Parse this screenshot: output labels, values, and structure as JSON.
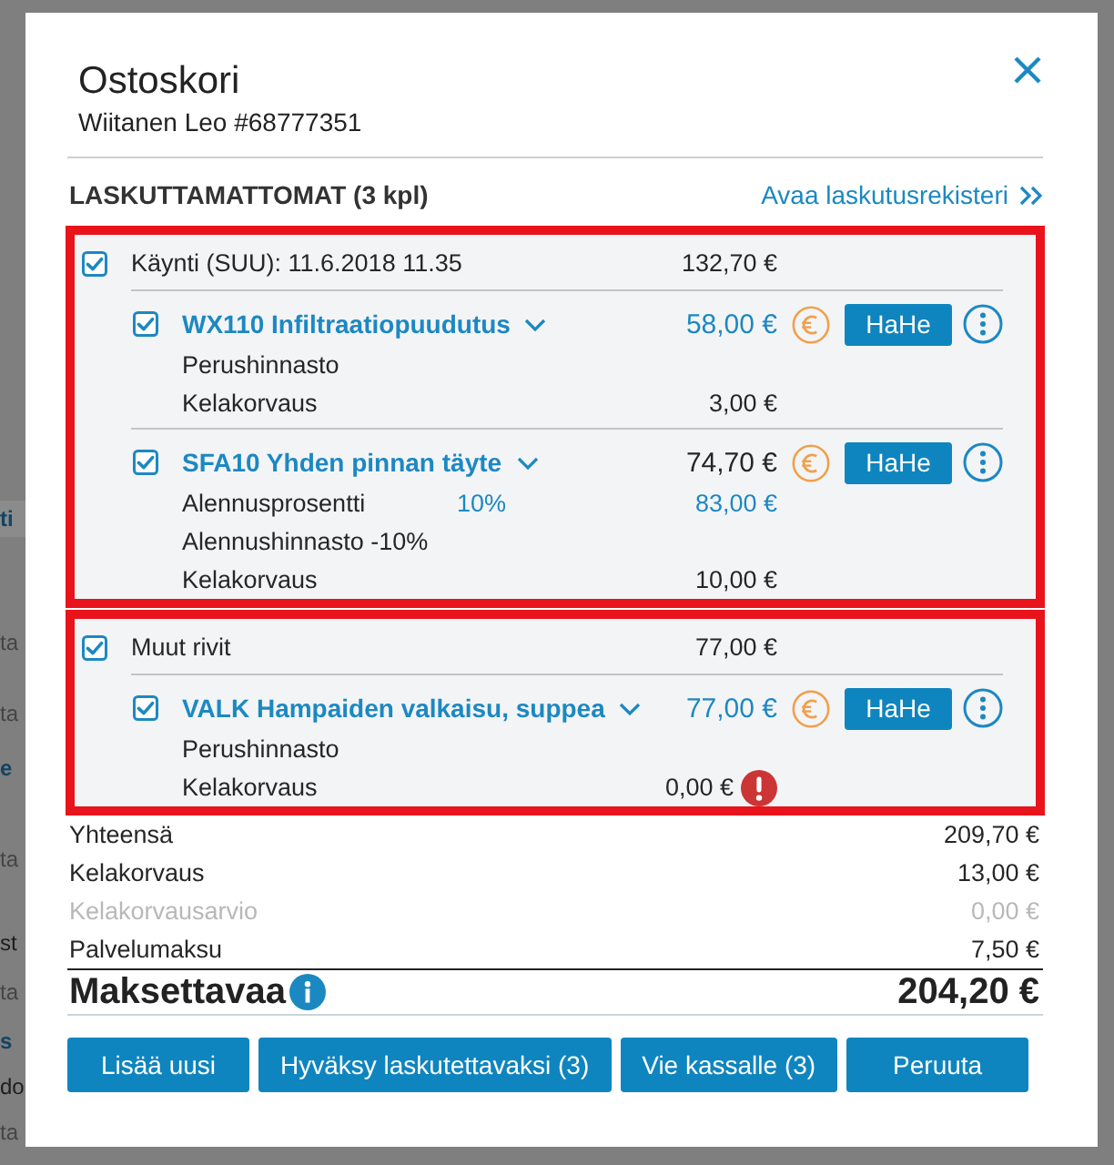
{
  "background_page": {
    "fragments": [
      {
        "text": "ti",
        "kind": "link",
        "selected": true
      },
      {
        "text": "ta",
        "kind": "meta",
        "selected": false
      },
      {
        "text": "ta",
        "kind": "meta",
        "selected": false
      },
      {
        "text": "e",
        "kind": "link",
        "selected": false
      },
      {
        "text": "ta",
        "kind": "meta",
        "selected": false
      },
      {
        "text": "st",
        "kind": "text",
        "selected": false
      },
      {
        "text": "ta",
        "kind": "meta",
        "selected": false
      },
      {
        "text": "s",
        "kind": "link",
        "selected": false
      },
      {
        "text": "do",
        "kind": "text",
        "selected": false
      },
      {
        "text": "ta",
        "kind": "meta",
        "selected": false
      }
    ]
  },
  "dialog": {
    "title": "Ostoskori",
    "subtitle": "Wiitanen Leo #68777351"
  },
  "section": {
    "title": "LASKUTTAMATTOMAT (3 kpl)",
    "link": "Avaa laskutusrekisteri"
  },
  "groups": [
    {
      "checked": true,
      "highlighted": true,
      "label": "Käynti (SUU): 11.6.2018 11.35",
      "amount": "132,70 €",
      "items": [
        {
          "checked": true,
          "name": "WX110 Infiltraatiopuudutus",
          "price": "58,00 €",
          "price_highlighted": true,
          "action": "HaHe",
          "lines": [
            {
              "kind": "price_list",
              "label": "Perushinnasto",
              "warning": false
            },
            {
              "kind": "reimbursement",
              "label": "Kelakorvaus",
              "value": "3,00 €",
              "warning": false
            }
          ]
        },
        {
          "checked": true,
          "name": "SFA10 Yhden pinnan täyte",
          "price": "74,70 €",
          "price_highlighted": false,
          "action": "HaHe",
          "lines": [
            {
              "kind": "discount",
              "label": "Alennusprosentti",
              "rate": "10%",
              "value": "83,00 €",
              "warning": false
            },
            {
              "kind": "price_list",
              "label": "Alennushinnasto -10%",
              "warning": false
            },
            {
              "kind": "reimbursement",
              "label": "Kelakorvaus",
              "value": "10,00 €",
              "warning": false
            }
          ]
        }
      ]
    },
    {
      "checked": true,
      "highlighted": true,
      "label": "Muut rivit",
      "amount": "77,00 €",
      "items": [
        {
          "checked": true,
          "name": "VALK Hampaiden valkaisu, suppea",
          "price": "77,00 €",
          "price_highlighted": true,
          "action": "HaHe",
          "lines": [
            {
              "kind": "price_list",
              "label": "Perushinnasto",
              "warning": false
            },
            {
              "kind": "reimbursement",
              "label": "Kelakorvaus",
              "value": "0,00 €",
              "warning": true
            }
          ]
        }
      ]
    }
  ],
  "totals": [
    {
      "label": "Yhteensä",
      "value": "209,70 €",
      "disabled": false
    },
    {
      "label": "Kelakorvaus",
      "value": "13,00 €",
      "disabled": false
    },
    {
      "label": "Kelakorvausarvio",
      "value": "0,00 €",
      "disabled": true
    },
    {
      "label": "Palvelumaksu",
      "value": "7,50 €",
      "disabled": false
    }
  ],
  "grand_total": {
    "label": "Maksettavaa",
    "value": "204,20 €"
  },
  "buttons": [
    "Lisää uusi",
    "Hyväksy laskutettavaksi (3)",
    "Vie kassalle (3)",
    "Peruuta"
  ]
}
